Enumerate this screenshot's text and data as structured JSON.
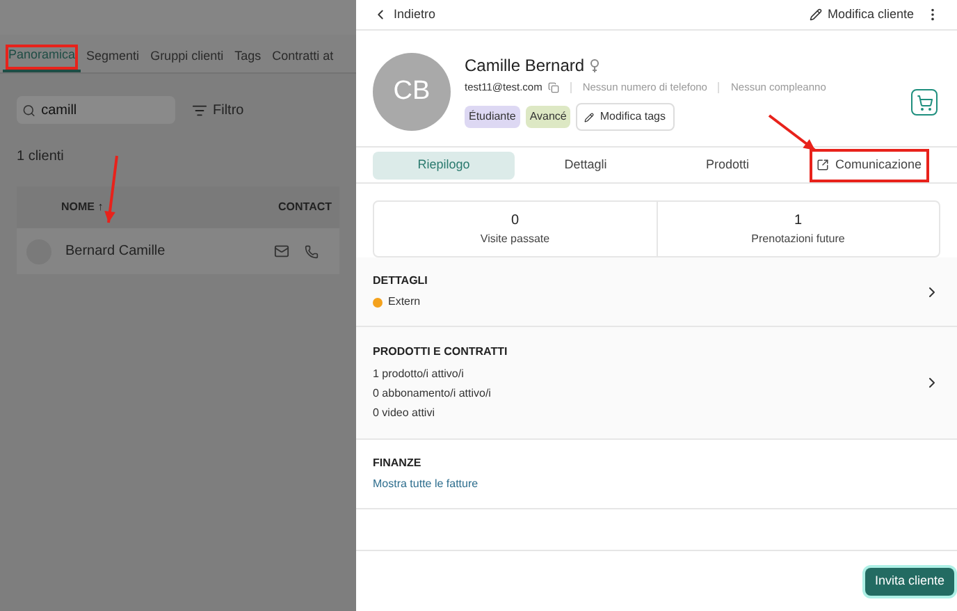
{
  "list_page": {
    "tabs": [
      {
        "label": "Panoramica",
        "selected": true,
        "annotated": true
      },
      {
        "label": "Segmenti",
        "selected": false,
        "annotated": false
      },
      {
        "label": "Gruppi clienti",
        "selected": false,
        "annotated": false
      },
      {
        "label": "Tags",
        "selected": false,
        "annotated": false
      },
      {
        "label": "Contratti at",
        "selected": false,
        "annotated": false
      }
    ],
    "search": {
      "value": "camill"
    },
    "filter_label": "Filtro",
    "count": "1 clienti",
    "table": {
      "columns": [
        "NOME ↑",
        "CONTACT"
      ],
      "rows": [
        {
          "name": "Bernard Camille"
        }
      ]
    }
  },
  "drawer": {
    "back": "Indietro",
    "edit": "Modifica cliente",
    "profile": {
      "initials": "CB",
      "name": "Camille Bernard",
      "email": "test11@test.com",
      "phone": "Nessun numero di telefono",
      "birthday": "Nessun compleanno",
      "tags": [
        {
          "label": "Étudiante",
          "color": "#ddd8f3"
        },
        {
          "label": "Avancé",
          "color": "#dde8c4"
        }
      ],
      "edit_tags": "Modifica tags"
    },
    "tabs": [
      {
        "label": "Riepilogo",
        "selected": true,
        "kind": "plain",
        "annotated": false
      },
      {
        "label": "Dettagli",
        "selected": false,
        "kind": "plain",
        "annotated": false
      },
      {
        "label": "Prodotti",
        "selected": false,
        "kind": "plain",
        "annotated": false
      },
      {
        "label": "Comunicazione",
        "selected": false,
        "kind": "external",
        "annotated": true
      }
    ],
    "stats": [
      {
        "value": "0",
        "label": "Visite passate"
      },
      {
        "value": "1",
        "label": "Prenotazioni future"
      }
    ],
    "sections": [
      {
        "title": "DETTAGLI",
        "kind": "status",
        "lines": [
          "Extern"
        ],
        "color": "#f4a21d",
        "chevron": true
      },
      {
        "title": "PRODOTTI E CONTRATTI",
        "kind": "list",
        "lines": [
          "1 prodotto/i attivo/i",
          "0 abbonamento/i attivo/i",
          "0 video attivi"
        ],
        "chevron": true
      },
      {
        "title": "FINANZE",
        "kind": "link",
        "lines": [
          "Mostra tutte le fatture"
        ],
        "chevron": false
      }
    ],
    "invite": "Invita cliente"
  }
}
